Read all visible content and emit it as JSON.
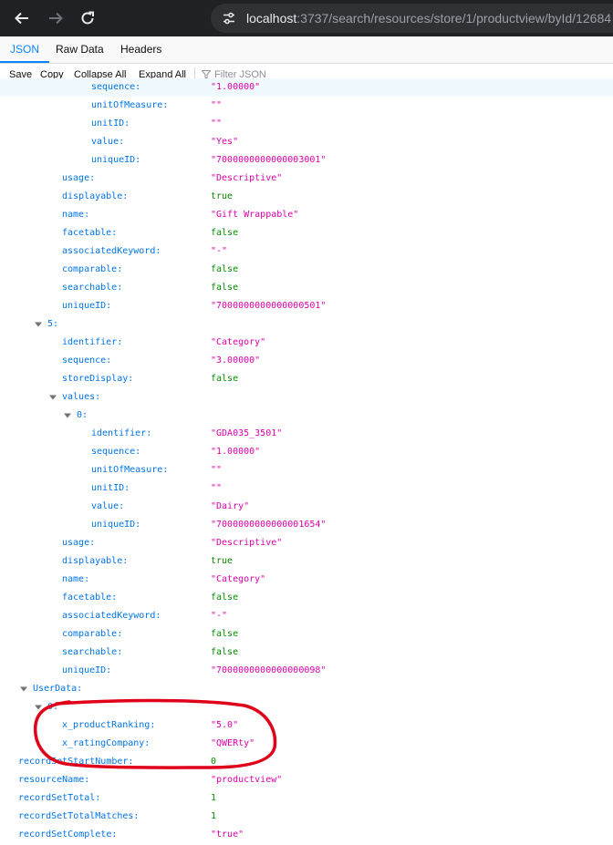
{
  "browser": {
    "url_host": "localhost",
    "url_rest": ":3737/search/resources/store/1/productview/byId/12684"
  },
  "viewer_tabs": [
    "JSON",
    "Raw Data",
    "Headers"
  ],
  "toolbar": {
    "save": "Save",
    "copy": "Copy",
    "collapse_all": "Collapse All",
    "expand_all": "Expand All",
    "filter_placeholder": "Filter JSON"
  },
  "colors": {
    "key": "#0074e8",
    "string": "#dd00a9",
    "literal": "#058b00",
    "annotation": "#e0001a"
  },
  "rows": [
    {
      "level": 6,
      "key": "sequence",
      "value": "\"1.00000\"",
      "type": "str"
    },
    {
      "level": 6,
      "key": "unitOfMeasure",
      "value": "\"\"",
      "type": "str"
    },
    {
      "level": 6,
      "key": "unitID",
      "value": "\"\"",
      "type": "str"
    },
    {
      "level": 6,
      "key": "value",
      "value": "\"Yes\"",
      "type": "str"
    },
    {
      "level": 6,
      "key": "uniqueID",
      "value": "\"7000000000000003001\"",
      "type": "str"
    },
    {
      "level": 4,
      "key": "usage",
      "value": "\"Descriptive\"",
      "type": "str"
    },
    {
      "level": 4,
      "key": "displayable",
      "value": "true",
      "type": "bool"
    },
    {
      "level": 4,
      "key": "name",
      "value": "\"Gift Wrappable\"",
      "type": "str"
    },
    {
      "level": 4,
      "key": "facetable",
      "value": "false",
      "type": "bool"
    },
    {
      "level": 4,
      "key": "associatedKeyword",
      "value": "\"-\"",
      "type": "str"
    },
    {
      "level": 4,
      "key": "comparable",
      "value": "false",
      "type": "bool"
    },
    {
      "level": 4,
      "key": "searchable",
      "value": "false",
      "type": "bool"
    },
    {
      "level": 4,
      "key": "uniqueID",
      "value": "\"7000000000000000501\"",
      "type": "str"
    },
    {
      "level": 3,
      "key": "5",
      "value": "",
      "type": "node"
    },
    {
      "level": 4,
      "key": "identifier",
      "value": "\"Category\"",
      "type": "str"
    },
    {
      "level": 4,
      "key": "sequence",
      "value": "\"3.00000\"",
      "type": "str"
    },
    {
      "level": 4,
      "key": "storeDisplay",
      "value": "false",
      "type": "bool"
    },
    {
      "level": 4,
      "key": "values",
      "value": "",
      "type": "node"
    },
    {
      "level": 5,
      "key": "0",
      "value": "",
      "type": "node"
    },
    {
      "level": 6,
      "key": "identifier",
      "value": "\"GDA035_3501\"",
      "type": "str"
    },
    {
      "level": 6,
      "key": "sequence",
      "value": "\"1.00000\"",
      "type": "str"
    },
    {
      "level": 6,
      "key": "unitOfMeasure",
      "value": "\"\"",
      "type": "str"
    },
    {
      "level": 6,
      "key": "unitID",
      "value": "\"\"",
      "type": "str"
    },
    {
      "level": 6,
      "key": "value",
      "value": "\"Dairy\"",
      "type": "str"
    },
    {
      "level": 6,
      "key": "uniqueID",
      "value": "\"7000000000000001654\"",
      "type": "str"
    },
    {
      "level": 4,
      "key": "usage",
      "value": "\"Descriptive\"",
      "type": "str"
    },
    {
      "level": 4,
      "key": "displayable",
      "value": "true",
      "type": "bool"
    },
    {
      "level": 4,
      "key": "name",
      "value": "\"Category\"",
      "type": "str"
    },
    {
      "level": 4,
      "key": "facetable",
      "value": "false",
      "type": "bool"
    },
    {
      "level": 4,
      "key": "associatedKeyword",
      "value": "\"-\"",
      "type": "str"
    },
    {
      "level": 4,
      "key": "comparable",
      "value": "false",
      "type": "bool"
    },
    {
      "level": 4,
      "key": "searchable",
      "value": "false",
      "type": "bool"
    },
    {
      "level": 4,
      "key": "uniqueID",
      "value": "\"7000000000000000098\"",
      "type": "str"
    },
    {
      "level": 2,
      "key": "UserData",
      "value": "",
      "type": "node"
    },
    {
      "level": 3,
      "key": "0",
      "value": "",
      "type": "node"
    },
    {
      "level": 4,
      "key": "x_productRanking",
      "value": "\"5.0\"",
      "type": "str"
    },
    {
      "level": 4,
      "key": "x_ratingCompany",
      "value": "\"QWERty\"",
      "type": "str"
    },
    {
      "level": 1,
      "key": "recordSetStartNumber",
      "value": "0",
      "type": "num"
    },
    {
      "level": 1,
      "key": "resourceName",
      "value": "\"productview\"",
      "type": "str"
    },
    {
      "level": 1,
      "key": "recordSetTotal",
      "value": "1",
      "type": "num"
    },
    {
      "level": 1,
      "key": "recordSetTotalMatches",
      "value": "1",
      "type": "num"
    },
    {
      "level": 1,
      "key": "recordSetComplete",
      "value": "\"true\"",
      "type": "str"
    }
  ]
}
